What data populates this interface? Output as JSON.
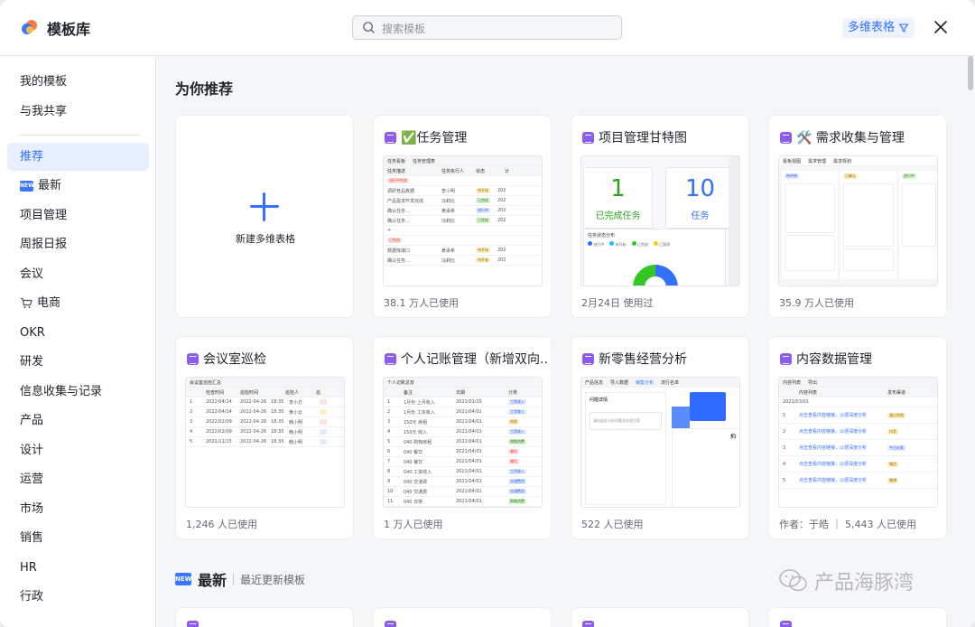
{
  "header": {
    "app_title": "模板库",
    "search_placeholder": "搜索模板",
    "filter_label": "多维表格"
  },
  "sidebar": {
    "items": [
      {
        "label": "我的模板"
      },
      {
        "label": "与我共享"
      },
      {
        "label": "推荐"
      },
      {
        "label": "最新",
        "badge": "NEW"
      },
      {
        "label": "项目管理"
      },
      {
        "label": "周报日报"
      },
      {
        "label": "会议"
      },
      {
        "label": "电商",
        "icon": "cart"
      },
      {
        "label": "OKR"
      },
      {
        "label": "研发"
      },
      {
        "label": "信息收集与记录"
      },
      {
        "label": "产品"
      },
      {
        "label": "设计"
      },
      {
        "label": "运营"
      },
      {
        "label": "市场"
      },
      {
        "label": "销售"
      },
      {
        "label": "HR"
      },
      {
        "label": "行政"
      }
    ]
  },
  "recommend": {
    "title": "为你推荐",
    "new_card_label": "新建多维表格",
    "cards": [
      {
        "title": "✅任务管理",
        "usage": "38.1 万人已使用"
      },
      {
        "title": "项目管理甘特图",
        "usage": "2月24日 使用过"
      },
      {
        "title": "🛠️ 需求收集与管理",
        "usage": "35.9 万人已使用"
      },
      {
        "title": "会议室巡检",
        "usage": "1,246 人已使用"
      },
      {
        "title": "个人记账管理（新增双向...",
        "usage": "1 万人已使用"
      },
      {
        "title": "新零售经营分析",
        "usage": "522 人已使用"
      },
      {
        "title": "内容数据管理",
        "usage": "作者：于皓 ｜ 5,443 人已使用"
      }
    ]
  },
  "previews": {
    "task": {
      "toolbar": [
        "任务看板",
        "任务管理表"
      ],
      "headers": [
        "任务描述",
        "任务执行人",
        "状态",
        "计"
      ],
      "group1": "进行中任务",
      "group2": "已完成",
      "rows": [
        {
          "task": "调研竞品数据",
          "owner": "李小明",
          "status": "待开始",
          "val": "202"
        },
        {
          "task": "产品需求开发完成",
          "owner": "冯莉比",
          "status": "已完成",
          "val": "202"
        },
        {
          "task": "确认任务...",
          "owner": "黄承希",
          "status": "进行中",
          "val": "202"
        },
        {
          "task": "确认任务...",
          "owner": "冯莉比",
          "status": "已完成",
          "val": "202"
        },
        {
          "task": "数据库接口",
          "owner": "黄承希",
          "status": "待开始",
          "val": "202"
        },
        {
          "task": "确认任务...",
          "owner": "冯莉比",
          "status": "待开始",
          "val": "202"
        }
      ]
    },
    "gantt": {
      "kpi1_value": "1",
      "kpi1_label": "已完成任务",
      "kpi2_value": "10",
      "kpi2_label": "任务",
      "chart_title": "任务状态分布",
      "legend": [
        "进行中",
        "未开始",
        "已完成",
        "已暂停"
      ]
    },
    "demand": {
      "views": [
        "看板视图",
        "需求管理",
        "需求规划"
      ],
      "groups": [
        "待评审",
        "已确认",
        "进行中"
      ]
    },
    "meeting": {
      "title": "会议室巡检汇总",
      "headers": [
        "检查时间",
        "巡检时间",
        "巡检人",
        "巡"
      ],
      "rows": [
        {
          "idx": "1",
          "date": "2022/04/14",
          "time": "2022-04-26",
          "hm": "18:35",
          "person": "李小方"
        },
        {
          "idx": "2",
          "date": "2022/04/14",
          "time": "2022-04-26",
          "hm": "18:35",
          "person": "黄小云"
        },
        {
          "idx": "3",
          "date": "2022/02/09",
          "time": "2022-04-26",
          "hm": "18:35",
          "person": "韩小明"
        },
        {
          "idx": "4",
          "date": "2022/02/09",
          "time": "2022-04-26",
          "hm": "18:35",
          "person": "韩小明"
        },
        {
          "idx": "5",
          "date": "2021/11/15",
          "time": "2022-04-26",
          "hm": "18:35",
          "person": "韩小明"
        }
      ]
    },
    "account": {
      "title": "个人记账总览",
      "headers": [
        "备注",
        "日期",
        "分类"
      ],
      "rows": [
        {
          "idx": "1",
          "note": "1月份 上月收入",
          "date": "2021/01/25",
          "cat": "工资收入"
        },
        {
          "idx": "2",
          "note": "1月份 工资收入",
          "date": "2021/04/01",
          "cat": "工资收入"
        },
        {
          "idx": "3",
          "note": "150元 房租",
          "date": "2021/04/01",
          "cat": "房租"
        },
        {
          "idx": "4",
          "note": "150元 收入",
          "date": "2021/04/01",
          "cat": "工资收入"
        },
        {
          "idx": "5",
          "note": "040 购物房租",
          "date": "2021/04/01",
          "cat": "购物消费"
        },
        {
          "idx": "6",
          "note": "040 餐饮",
          "date": "2021/04/01",
          "cat": "餐饮"
        },
        {
          "idx": "7",
          "note": "040 餐饮",
          "date": "2021/04/01",
          "cat": "餐饮"
        },
        {
          "idx": "8",
          "note": "040 工资收入",
          "date": "2021/04/01",
          "cat": "工资收入"
        },
        {
          "idx": "9",
          "note": "040 交通费",
          "date": "2021/04/01",
          "cat": "交通费用"
        },
        {
          "idx": "10",
          "note": "040 交通费",
          "date": "2021/04/01",
          "cat": "交通费用"
        },
        {
          "idx": "11",
          "note": "040 日常",
          "date": "2021/04/01",
          "cat": "购物消费"
        }
      ]
    },
    "retail": {
      "tabs": [
        "产品信息",
        "导入数据",
        "销售分析",
        "流行名单"
      ],
      "form_title": "问题详情",
      "form_hint": "请在此处分析问题及处理方案",
      "side_text": "拍"
    },
    "content": {
      "toolbar": [
        "内容列表",
        "导出"
      ],
      "headers": [
        "内容列表",
        "发布渠道"
      ],
      "group": "2021/03/01",
      "rows": [
        {
          "idx": "1",
          "link": "点击查看内容链接，以便深度分析",
          "tag": "通过视频"
        },
        {
          "idx": "2",
          "link": "点击查看内容链接，以便深度分析",
          "tag": "抖音"
        },
        {
          "idx": "3",
          "link": "点击查看内容链接，以便深度分析",
          "tag": "今日头条"
        },
        {
          "idx": "4",
          "link": "点击查看内容链接，以便深度分析",
          "tag": "微信"
        },
        {
          "idx": "5",
          "link": "点击查看内容链接，以便深度分析",
          "tag": "微博"
        }
      ]
    }
  },
  "latest": {
    "badge": "NEW",
    "title": "最新",
    "subtitle": "最近更新模板"
  },
  "watermark": "产品海豚湾",
  "colors": {
    "accent": "#3370ff",
    "sidebar_active_bg": "#e8efff",
    "template_icon": "#8c5cf0",
    "kpi_green": "#2ea121",
    "kpi_blue": "#3370ff"
  }
}
